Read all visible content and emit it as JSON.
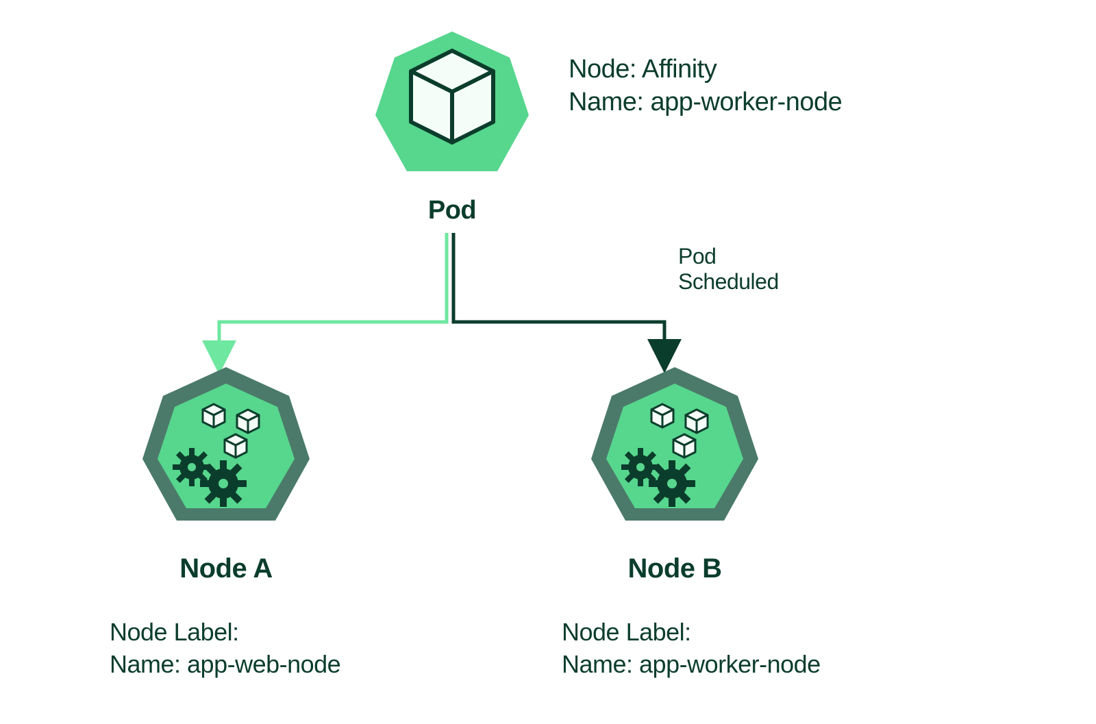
{
  "pod": {
    "label": "Pod",
    "info_line1": "Node: Affinity",
    "info_line2": "Name: app-worker-node"
  },
  "arrow": {
    "scheduled_label_line1": "Pod",
    "scheduled_label_line2": "Scheduled"
  },
  "nodes": {
    "a": {
      "title": "Node A",
      "label_heading": "Node Label:",
      "label_name": "Name: app-web-node"
    },
    "b": {
      "title": "Node B",
      "label_heading": "Node Label:",
      "label_name": "Name: app-worker-node"
    }
  },
  "colors": {
    "dark": "#0b3d2c",
    "green": "#57d68d",
    "green_light": "#6ee7a0",
    "node_border": "#4b7a6a",
    "cube_face": "#f4fdf8"
  }
}
